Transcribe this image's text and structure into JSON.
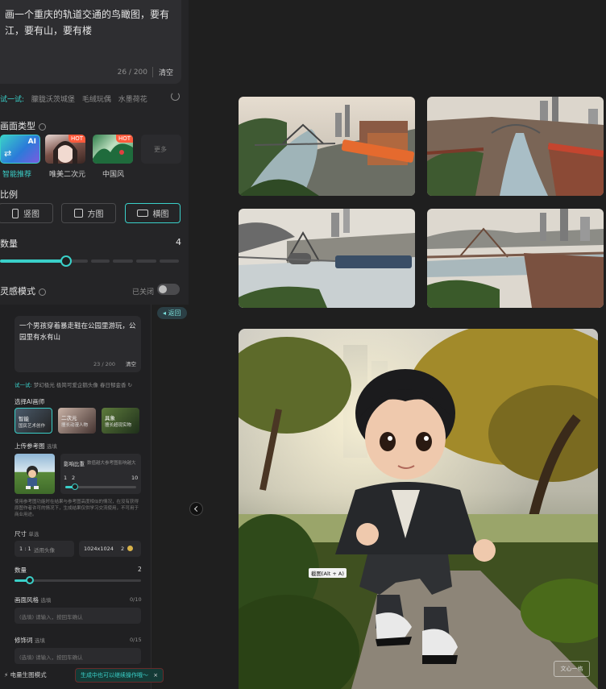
{
  "top_panel": {
    "prompt": "画一个重庆的轨道交通的鸟瞰图，要有江，要有山，要有楼",
    "counter": "26 / 200",
    "clear_label": "清空",
    "try_label": "试一试:",
    "suggestions": [
      "朦胧沃茨城堡",
      "毛绒玩偶",
      "水墨荷花"
    ],
    "style_section_label": "画面类型",
    "styles": [
      {
        "label": "智能推荐",
        "badge": "AI",
        "active": true
      },
      {
        "label": "唯美二次元",
        "badge": "HOT"
      },
      {
        "label": "中国风",
        "badge": "HOT"
      },
      {
        "label": "更多"
      }
    ],
    "ratio_label": "比例",
    "ratios": [
      {
        "label": "竖图",
        "active": false
      },
      {
        "label": "方图",
        "active": false
      },
      {
        "label": "横图",
        "active": true
      }
    ],
    "quantity_label": "数量",
    "quantity_value": "4",
    "quantity_level": 0.33,
    "inspiration_label": "灵感模式",
    "inspiration_state": "已关闭",
    "accent_color": "#3ad0c9"
  },
  "lower_panel": {
    "back_label": "返回",
    "prompt": "一个男孩穿着暴走鞋在公园里游玩，公园里有水有山",
    "counter": "23 / 200",
    "clear_label": "清空",
    "try_label": "试一试:",
    "suggestions": [
      "梦幻极光",
      "极简可爱企鹅头像",
      "春日郁金香"
    ],
    "painter_label": "选择AI画师",
    "painters": [
      {
        "label": "智能",
        "sub": "国民艺术创作"
      },
      {
        "label": "二次元",
        "sub": "擅长动漫人物"
      },
      {
        "label": "具象",
        "sub": "擅长超现实物"
      }
    ],
    "reference_label": "上传参考图",
    "reference_optional": "选填",
    "influence_label": "影响比重",
    "influence_hint": "数值越大参考图影响越大",
    "influence_min": "1",
    "influence_value": "2",
    "influence_max": "10",
    "reference_notice": "使用参考图功能时在结果与参考图高度相似的情况，在没有获得原图作者许可的情况下，生成结果仅供学习交流使用，不可用于商业用途。",
    "size_label": "尺寸",
    "size_sub": "单选",
    "size_ratio": "1 : 1",
    "size_ratio_hint": "适用头像",
    "size_resolution": "1024x1024",
    "size_multiplier": "2",
    "quantity_label": "数量",
    "quantity_value": "2",
    "style_label": "画面风格",
    "style_optional": "选填",
    "style_counter": "0/10",
    "style_placeholder": "(选填) 请输入，按回车确认",
    "modifier_label": "修饰词",
    "modifier_optional": "选填",
    "modifier_counter": "0/15",
    "modifier_placeholder": "(选填) 请输入，按回车确认",
    "mode_label": "电量生图模式",
    "toast": "生成中也可以继续操作哦～",
    "toast_close": "×"
  },
  "main_image": {
    "tooltip": "截图(Alt + A)",
    "watermark": "文心一格"
  }
}
